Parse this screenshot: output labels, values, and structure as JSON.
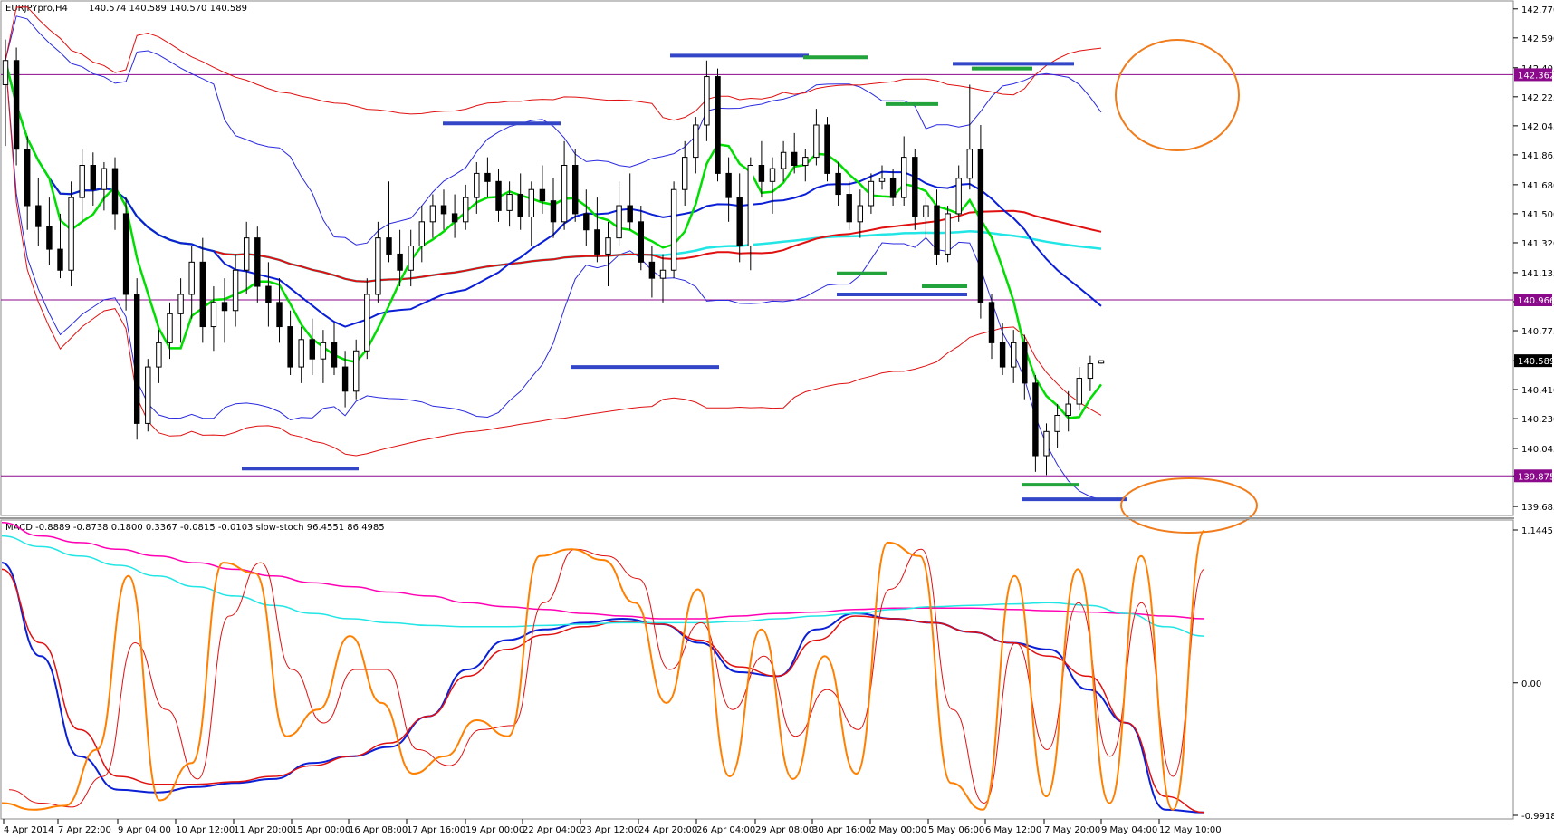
{
  "chart_data": [
    {
      "type": "candlestick",
      "title": "EURJPYpro,H4",
      "ohlc_text": "140.574 140.589 140.570 140.589",
      "y_ticks": [
        "142.770",
        "142.590",
        "142.405",
        "142.225",
        "142.045",
        "141.865",
        "141.680",
        "141.500",
        "141.320",
        "141.135",
        "140.955",
        "140.775",
        "140.589",
        "140.410",
        "140.230",
        "140.045",
        "139.875",
        "139.685"
      ],
      "y_range": [
        139.68,
        142.78
      ],
      "horizontal_levels": [
        {
          "value": 142.362,
          "label": "142.362",
          "color": "#8b0a8b"
        },
        {
          "value": 140.966,
          "label": "140.966",
          "color": "#8b0a8b"
        },
        {
          "value": 139.875,
          "label": "139.875",
          "color": "#8b0a8b"
        }
      ],
      "current_price": {
        "value": 140.589,
        "label": "140.589"
      },
      "x_labels": [
        "4 Apr 2014",
        "7 Apr 22:00",
        "9 Apr 04:00",
        "10 Apr 12:00",
        "11 Apr 20:00",
        "15 Apr 00:00",
        "16 Apr 08:00",
        "17 Apr 16:00",
        "19 Apr 00:00",
        "22 Apr 04:00",
        "23 Apr 12:00",
        "24 Apr 20:00",
        "26 Apr 04:00",
        "29 Apr 08:00",
        "30 Apr 16:00",
        "2 May 00:00",
        "5 May 06:00",
        "6 May 12:00",
        "7 May 20:00",
        "9 May 04:00",
        "12 May 10:00"
      ],
      "candles": [
        [
          142.3,
          142.58,
          141.92,
          142.45
        ],
        [
          142.45,
          142.53,
          141.8,
          141.9
        ],
        [
          141.9,
          141.98,
          141.4,
          141.55
        ],
        [
          141.55,
          141.72,
          141.3,
          141.42
        ],
        [
          141.42,
          141.6,
          141.18,
          141.28
        ],
        [
          141.28,
          141.5,
          141.1,
          141.15
        ],
        [
          141.15,
          141.7,
          141.05,
          141.6
        ],
        [
          141.6,
          141.9,
          141.45,
          141.8
        ],
        [
          141.8,
          141.88,
          141.55,
          141.65
        ],
        [
          141.65,
          141.82,
          141.52,
          141.78
        ],
        [
          141.78,
          141.85,
          141.4,
          141.5
        ],
        [
          141.5,
          141.6,
          140.9,
          141.0
        ],
        [
          141.0,
          141.1,
          140.1,
          140.2
        ],
        [
          140.2,
          140.6,
          140.15,
          140.55
        ],
        [
          140.55,
          140.78,
          140.45,
          140.7
        ],
        [
          140.7,
          140.95,
          140.6,
          140.88
        ],
        [
          140.88,
          141.1,
          140.7,
          141.0
        ],
        [
          141.0,
          141.3,
          140.85,
          141.2
        ],
        [
          141.2,
          141.35,
          140.7,
          140.8
        ],
        [
          140.8,
          141.05,
          140.65,
          140.95
        ],
        [
          140.95,
          141.1,
          140.7,
          140.9
        ],
        [
          140.9,
          141.25,
          140.8,
          141.15
        ],
        [
          141.15,
          141.45,
          141.0,
          141.35
        ],
        [
          141.35,
          141.42,
          140.95,
          141.05
        ],
        [
          141.05,
          141.2,
          140.8,
          140.95
        ],
        [
          140.95,
          141.1,
          140.7,
          140.8
        ],
        [
          140.8,
          140.9,
          140.5,
          140.55
        ],
        [
          140.55,
          140.8,
          140.45,
          140.72
        ],
        [
          140.72,
          140.85,
          140.5,
          140.6
        ],
        [
          140.6,
          140.78,
          140.45,
          140.7
        ],
        [
          140.7,
          140.82,
          140.5,
          140.55
        ],
        [
          140.55,
          140.65,
          140.3,
          140.4
        ],
        [
          140.4,
          140.72,
          140.35,
          140.65
        ],
        [
          140.65,
          141.1,
          140.6,
          141.0
        ],
        [
          141.0,
          141.45,
          140.95,
          141.35
        ],
        [
          141.35,
          141.7,
          141.2,
          141.25
        ],
        [
          141.25,
          141.4,
          141.05,
          141.15
        ],
        [
          141.15,
          141.4,
          141.05,
          141.3
        ],
        [
          141.3,
          141.55,
          141.2,
          141.45
        ],
        [
          141.45,
          141.62,
          141.35,
          141.55
        ],
        [
          141.55,
          141.65,
          141.4,
          141.5
        ],
        [
          141.5,
          141.62,
          141.35,
          141.45
        ],
        [
          141.45,
          141.68,
          141.4,
          141.6
        ],
        [
          141.6,
          141.82,
          141.5,
          141.75
        ],
        [
          141.75,
          141.85,
          141.6,
          141.7
        ],
        [
          141.7,
          141.78,
          141.45,
          141.52
        ],
        [
          141.52,
          141.7,
          141.42,
          141.62
        ],
        [
          141.62,
          141.75,
          141.4,
          141.48
        ],
        [
          141.48,
          141.7,
          141.3,
          141.65
        ],
        [
          141.65,
          141.8,
          141.5,
          141.58
        ],
        [
          141.58,
          141.72,
          141.35,
          141.45
        ],
        [
          141.45,
          141.95,
          141.4,
          141.8
        ],
        [
          141.8,
          141.9,
          141.45,
          141.5
        ],
        [
          141.5,
          141.65,
          141.3,
          141.4
        ],
        [
          141.4,
          141.6,
          141.2,
          141.25
        ],
        [
          141.25,
          141.45,
          141.05,
          141.35
        ],
        [
          141.35,
          141.7,
          141.3,
          141.55
        ],
        [
          141.55,
          141.75,
          141.4,
          141.45
        ],
        [
          141.45,
          141.55,
          141.15,
          141.2
        ],
        [
          141.2,
          141.3,
          140.98,
          141.1
        ],
        [
          141.1,
          141.25,
          140.95,
          141.15
        ],
        [
          141.15,
          141.7,
          141.1,
          141.65
        ],
        [
          141.65,
          141.95,
          141.55,
          141.85
        ],
        [
          141.85,
          142.1,
          141.75,
          142.05
        ],
        [
          142.05,
          142.45,
          141.95,
          142.35
        ],
        [
          142.35,
          142.4,
          141.7,
          141.75
        ],
        [
          141.75,
          141.85,
          141.45,
          141.6
        ],
        [
          141.6,
          141.75,
          141.2,
          141.3
        ],
        [
          141.3,
          141.85,
          141.15,
          141.8
        ],
        [
          141.8,
          141.95,
          141.6,
          141.7
        ],
        [
          141.7,
          141.85,
          141.5,
          141.78
        ],
        [
          141.78,
          141.95,
          141.7,
          141.88
        ],
        [
          141.88,
          142.0,
          141.75,
          141.8
        ],
        [
          141.8,
          141.9,
          141.7,
          141.85
        ],
        [
          141.85,
          142.15,
          141.8,
          142.05
        ],
        [
          142.05,
          142.1,
          141.7,
          141.75
        ],
        [
          141.75,
          141.82,
          141.55,
          141.62
        ],
        [
          141.62,
          141.7,
          141.4,
          141.45
        ],
        [
          141.45,
          141.65,
          141.35,
          141.55
        ],
        [
          141.55,
          141.75,
          141.5,
          141.7
        ],
        [
          141.7,
          141.8,
          141.65,
          141.72
        ],
        [
          141.72,
          141.78,
          141.55,
          141.6
        ],
        [
          141.6,
          141.98,
          141.55,
          141.85
        ],
        [
          141.85,
          141.9,
          141.4,
          141.48
        ],
        [
          141.48,
          141.6,
          141.35,
          141.55
        ],
        [
          141.55,
          141.65,
          141.18,
          141.25
        ],
        [
          141.25,
          141.55,
          141.2,
          141.5
        ],
        [
          141.5,
          141.8,
          141.45,
          141.72
        ],
        [
          141.72,
          142.3,
          141.65,
          141.9
        ],
        [
          141.9,
          142.05,
          140.85,
          140.95
        ],
        [
          140.95,
          141.0,
          140.6,
          140.7
        ],
        [
          140.7,
          140.82,
          140.5,
          140.55
        ],
        [
          140.55,
          140.78,
          140.45,
          140.7
        ],
        [
          140.7,
          140.75,
          140.35,
          140.45
        ],
        [
          140.45,
          140.5,
          139.9,
          140.0
        ],
        [
          140.0,
          140.2,
          139.88,
          140.15
        ],
        [
          140.15,
          140.32,
          140.05,
          140.25
        ],
        [
          140.25,
          140.4,
          140.15,
          140.32
        ],
        [
          140.32,
          140.55,
          140.28,
          140.48
        ],
        [
          140.48,
          140.62,
          140.4,
          140.57
        ],
        [
          140.574,
          140.589,
          140.57,
          140.589
        ]
      ],
      "series": [
        {
          "name": "",
          "color": "#00dd00"
        },
        {
          "name": "",
          "color": "#0a1fd6"
        },
        {
          "name": "",
          "color": "#e01010"
        },
        {
          "name": "",
          "color": "#22e5e5"
        }
      ],
      "bands": {
        "color_blue": "#2a2ae0",
        "color_red": "#e01010"
      },
      "marker_colors": {
        "blue": "#3346c7",
        "green": "#22a33b"
      },
      "marker_segments": [
        {
          "color": "blue",
          "x": [
            267,
            396
          ],
          "y": 139.92
        },
        {
          "color": "blue",
          "x": [
            489,
            619
          ],
          "y": 142.06
        },
        {
          "color": "blue",
          "x": [
            630,
            794
          ],
          "y": 140.55
        },
        {
          "color": "blue",
          "x": [
            740,
            893
          ],
          "y": 142.48
        },
        {
          "color": "green",
          "x": [
            887,
            958
          ],
          "y": 142.47
        },
        {
          "color": "green",
          "x": [
            978,
            1036
          ],
          "y": 142.18
        },
        {
          "color": "green",
          "x": [
            924,
            979
          ],
          "y": 141.13
        },
        {
          "color": "blue",
          "x": [
            924,
            1068
          ],
          "y": 141.0
        },
        {
          "color": "green",
          "x": [
            1018,
            1068
          ],
          "y": 141.05
        },
        {
          "color": "blue",
          "x": [
            1052,
            1186
          ],
          "y": 142.43
        },
        {
          "color": "green",
          "x": [
            1073,
            1140
          ],
          "y": 142.4
        },
        {
          "color": "green",
          "x": [
            1128,
            1192
          ],
          "y": 139.82
        },
        {
          "color": "blue",
          "x": [
            1128,
            1245
          ],
          "y": 139.73
        }
      ],
      "annotation_ellipses": [
        {
          "target": "upper-right",
          "color": "#f07c1c"
        },
        {
          "target": "lower-right",
          "color": "#f07c1c"
        }
      ]
    },
    {
      "type": "line",
      "header_text": "MACD -0.8889 -0.8738 0.1800 0.3367 -0.0815 -0.0103  slow-stoch 96.4551 86.4985",
      "y_ticks": [
        "1.1445",
        "0.00",
        "-0.9918"
      ],
      "y_range": [
        -0.9918,
        1.1445
      ],
      "series": [
        {
          "name": "",
          "color": "#0a1fd6",
          "values": [
            0.9,
            0.2,
            -0.55,
            -0.8,
            -0.82,
            -0.78,
            -0.75,
            -0.72,
            -0.6,
            -0.55,
            -0.48,
            -0.25,
            0.1,
            0.32,
            0.4,
            0.45,
            0.48,
            0.44,
            0.3,
            0.08,
            0.05,
            0.4,
            0.52,
            0.48,
            0.45,
            0.38,
            0.3,
            0.25,
            -0.05,
            -0.3,
            -0.95,
            -0.97
          ]
        },
        {
          "name": "",
          "color": "#e01010",
          "values": [
            0.85,
            0.3,
            -0.35,
            -0.7,
            -0.76,
            -0.76,
            -0.74,
            -0.7,
            -0.62,
            -0.55,
            -0.45,
            -0.25,
            0.05,
            0.25,
            0.36,
            0.42,
            0.46,
            0.44,
            0.32,
            0.12,
            0.05,
            0.32,
            0.5,
            0.48,
            0.45,
            0.38,
            0.3,
            0.2,
            0.05,
            -0.3,
            -0.85,
            -0.97
          ]
        },
        {
          "name": "",
          "color": "#ff00b4",
          "values": [
            1.2,
            1.1,
            1.05,
            1.0,
            0.95,
            0.9,
            0.85,
            0.8,
            0.75,
            0.72,
            0.68,
            0.65,
            0.6,
            0.57,
            0.55,
            0.52,
            0.5,
            0.48,
            0.48,
            0.5,
            0.52,
            0.53,
            0.55,
            0.56,
            0.56,
            0.56,
            0.55,
            0.54,
            0.53,
            0.52,
            0.5,
            0.48
          ]
        },
        {
          "name": "",
          "color": "#22e5e5",
          "values": [
            1.1,
            1.02,
            0.95,
            0.88,
            0.8,
            0.72,
            0.65,
            0.58,
            0.52,
            0.48,
            0.45,
            0.43,
            0.42,
            0.42,
            0.43,
            0.44,
            0.45,
            0.45,
            0.45,
            0.46,
            0.48,
            0.5,
            0.52,
            0.55,
            0.57,
            0.58,
            0.59,
            0.6,
            0.58,
            0.52,
            0.42,
            0.35
          ]
        }
      ],
      "stochastic": [
        {
          "name": "",
          "color": "#ff7f00",
          "values": [
            -0.9,
            -0.95,
            -0.92,
            -0.5,
            0.8,
            -0.88,
            -0.6,
            0.9,
            0.82,
            -0.4,
            -0.2,
            0.35,
            -0.15,
            -0.68,
            -0.55,
            -0.28,
            -0.4,
            0.95,
            1.0,
            0.92,
            0.6,
            -0.15,
            0.7,
            -0.7,
            0.4,
            -0.72,
            0.2,
            -0.68,
            1.05,
            0.95,
            -0.75,
            -0.95,
            0.8,
            -0.85,
            0.85,
            -0.9,
            0.95,
            -0.95,
            1.14
          ]
        },
        {
          "name": "",
          "color": "#e01010",
          "values": [
            -0.8,
            -0.9,
            -0.93,
            -0.7,
            0.3,
            -0.2,
            -0.72,
            0.5,
            0.9,
            0.1,
            -0.3,
            0.1,
            0.1,
            -0.5,
            -0.62,
            -0.35,
            -0.32,
            0.6,
            1.0,
            0.95,
            0.78,
            0.1,
            0.45,
            -0.2,
            0.2,
            -0.4,
            -0.05,
            -0.35,
            0.7,
            1.0,
            -0.2,
            -0.9,
            0.3,
            -0.5,
            0.6,
            -0.55,
            0.6,
            -0.7,
            0.85
          ]
        }
      ]
    }
  ]
}
